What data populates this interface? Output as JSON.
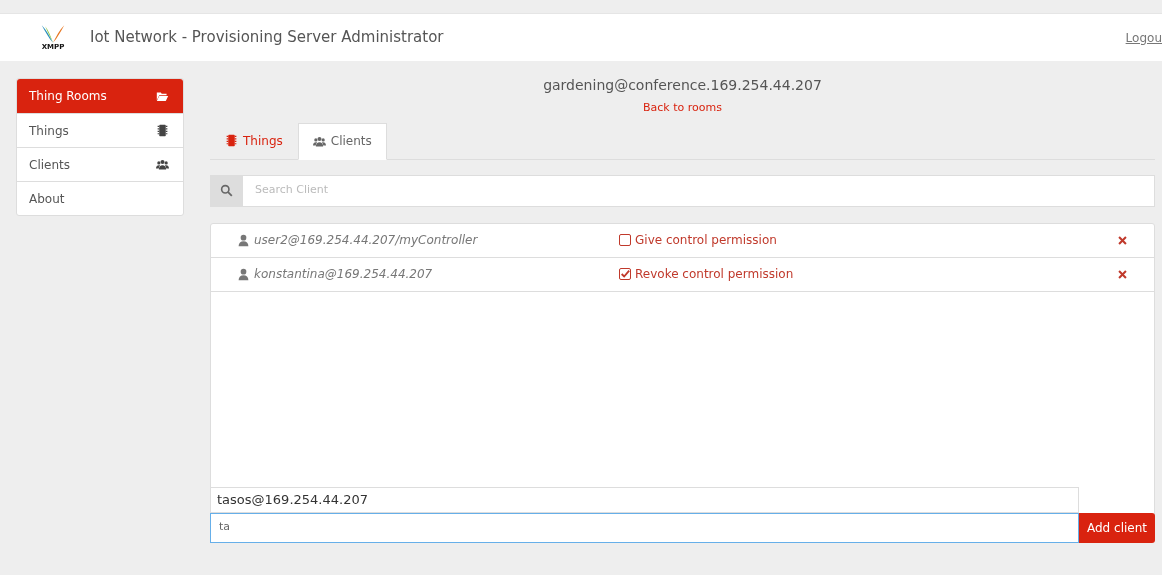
{
  "header": {
    "logo_text": "XMPP",
    "title": "Iot Network - Provisioning Server Administrator",
    "logout": "Logou"
  },
  "sidebar": {
    "items": [
      {
        "label": "Thing Rooms",
        "selected": true
      },
      {
        "label": "Things",
        "selected": false
      },
      {
        "label": "Clients",
        "selected": false
      },
      {
        "label": "About",
        "selected": false
      }
    ]
  },
  "room": {
    "title": "gardening@conference.169.254.44.207",
    "back_link": "Back to rooms"
  },
  "tabs": [
    {
      "label": "Things",
      "selected": false
    },
    {
      "label": "Clients",
      "selected": true
    }
  ],
  "search": {
    "placeholder": "Search Client"
  },
  "clients": [
    {
      "jid": "user2@169.254.44.207/myController",
      "permission": "Give control permission",
      "checked": false
    },
    {
      "jid": "konstantina@169.254.44.207",
      "permission": "Revoke control permission",
      "checked": true
    }
  ],
  "add_client": {
    "suggestion": "tasos@169.254.44.207",
    "value": "ta",
    "button": "Add client"
  }
}
